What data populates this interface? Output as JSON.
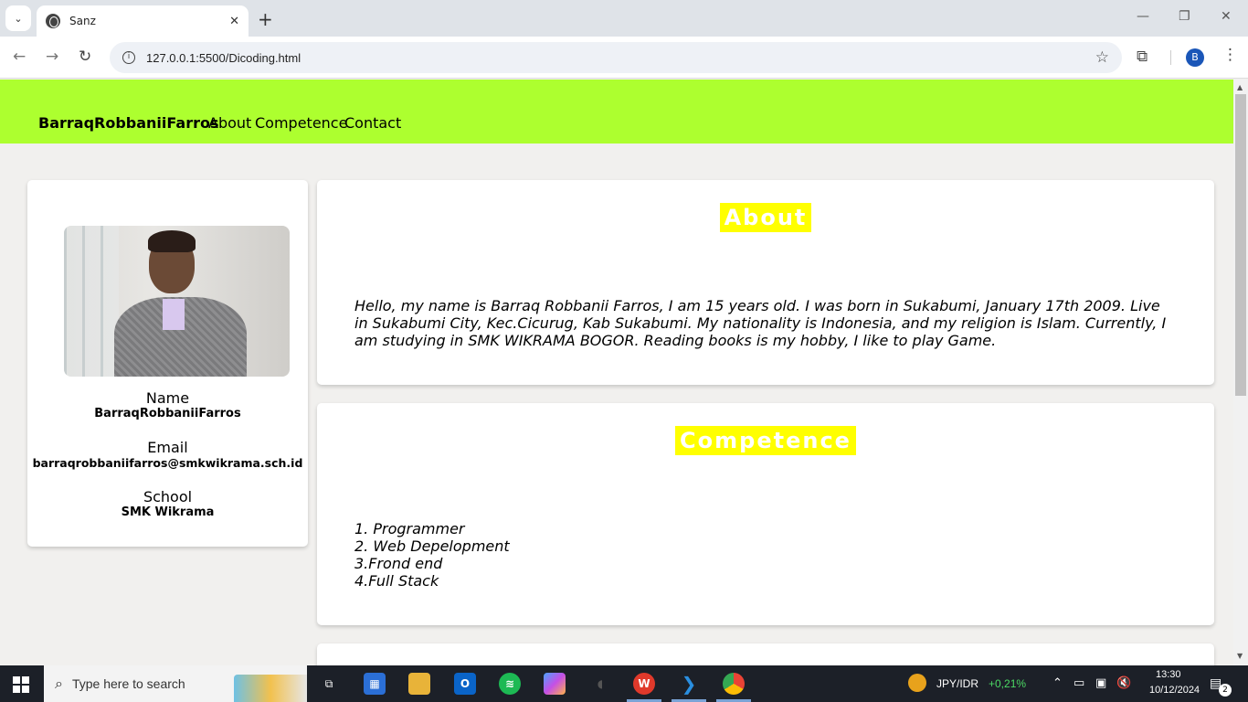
{
  "browser": {
    "tab_title": "Sanz",
    "url": "127.0.0.1:5500/Dicoding.html",
    "profile_initial": "B"
  },
  "site": {
    "brand": "BarraqRobbaniiFarros",
    "nav": [
      "About",
      "Competence",
      "Contact"
    ],
    "accent_color": "#adff2f",
    "heading_bg_color": "#ffff00"
  },
  "profile": {
    "name_label": "Name",
    "name_value": "BarraqRobbaniiFarros",
    "email_label": "Email",
    "email_value": "barraqrobbaniifarros@smkwikrama.sch.id",
    "school_label": "School",
    "school_value": "SMK Wikrama"
  },
  "about": {
    "title": "About",
    "text": "Hello, my name is Barraq Robbanii Farros, I am 15 years old. I was born in Sukabumi, January 17th 2009. Live in Sukabumi City, Kec.Cicurug, Kab Sukabumi. My nationality is Indonesia, and my religion is Islam. Currently, I am studying in SMK WIKRAMA BOGOR. Reading books is my hobby, I like to play Game."
  },
  "competence": {
    "title": "Competence",
    "items": [
      "1. Programmer",
      "2. Web Depelopment",
      "3.Frond end",
      "4.Full Stack"
    ]
  },
  "taskbar": {
    "search_placeholder": "Type here to search",
    "ticker_name": "JPY/IDR",
    "ticker_change": "+0,21%",
    "time": "13:30",
    "date": "10/12/2024",
    "notification_count": "2"
  }
}
